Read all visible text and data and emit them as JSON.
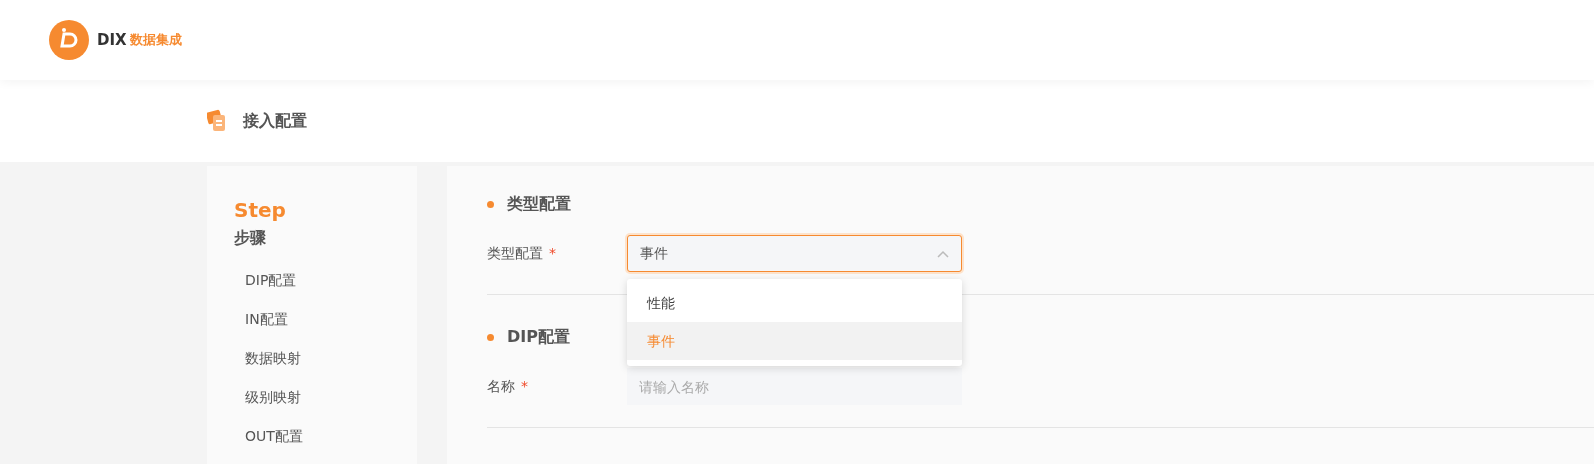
{
  "logo": {
    "brand": "DIX",
    "product": "数据集成"
  },
  "page_title": "接入配置",
  "steps": {
    "title": "Step",
    "subtitle": "步骤",
    "items": [
      {
        "label": "DIP配置"
      },
      {
        "label": "IN配置"
      },
      {
        "label": "数据映射"
      },
      {
        "label": "级别映射"
      },
      {
        "label": "OUT配置"
      }
    ]
  },
  "sections": [
    {
      "heading": "类型配置",
      "field": {
        "label": "类型配置",
        "required_mark": "*",
        "kind": "select",
        "value": "事件",
        "expanded": true,
        "options": [
          {
            "label": "性能",
            "selected": false
          },
          {
            "label": "事件",
            "selected": true
          }
        ]
      }
    },
    {
      "heading": "DIP配置",
      "field": {
        "label": "名称",
        "required_mark": "*",
        "kind": "input",
        "placeholder": "请输入名称"
      }
    }
  ]
}
